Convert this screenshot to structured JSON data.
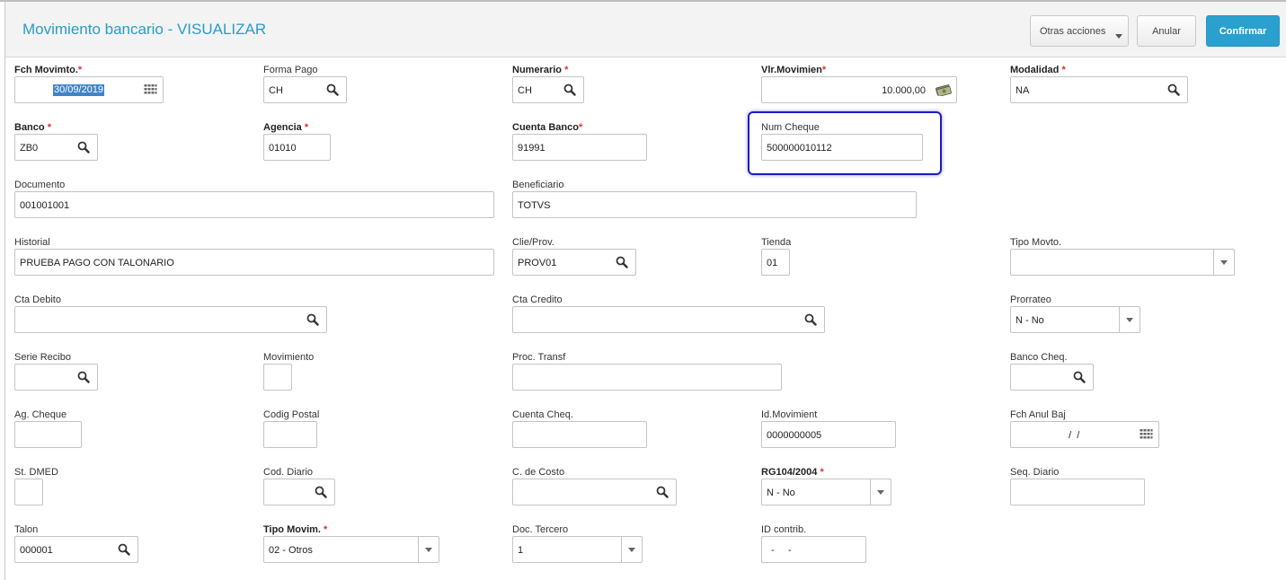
{
  "header": {
    "title": "Movimiento bancario - VISUALIZAR",
    "buttons": {
      "otras": "Otras acciones",
      "anular": "Anular",
      "confirmar": "Confirmar"
    }
  },
  "colors": {
    "accent": "#2aa0cf",
    "required": "#e03030",
    "highlight": "#1a1acc"
  },
  "fields": {
    "fch_movimto": {
      "label": "Fch Movimto.",
      "value": "30/09/2019"
    },
    "forma_pago": {
      "label": "Forma Pago",
      "value": "CH"
    },
    "numerario": {
      "label": "Numerario",
      "value": "CH"
    },
    "vlr_movimien": {
      "label": "Vlr.Movimien",
      "value": "10.000,00"
    },
    "modalidad": {
      "label": "Modalidad",
      "value": "NA"
    },
    "banco": {
      "label": "Banco",
      "value": "ZB0"
    },
    "agencia": {
      "label": "Agencia",
      "value": "01010"
    },
    "cuenta_banco": {
      "label": "Cuenta Banco",
      "value": "91991"
    },
    "num_cheque": {
      "label": "Num Cheque",
      "value": "500000010112"
    },
    "documento": {
      "label": "Documento",
      "value": "001001001"
    },
    "beneficiario": {
      "label": "Beneficiario",
      "value": "TOTVS"
    },
    "historial": {
      "label": "Historial",
      "value": "PRUEBA PAGO CON TALONARIO"
    },
    "clie_prov": {
      "label": "Clie/Prov.",
      "value": "PROV01"
    },
    "tienda": {
      "label": "Tienda",
      "value": "01"
    },
    "tipo_movto": {
      "label": "Tipo Movto.",
      "value": ""
    },
    "cta_debito": {
      "label": "Cta Debito",
      "value": ""
    },
    "cta_credito": {
      "label": "Cta Credito",
      "value": ""
    },
    "prorrateo": {
      "label": "Prorrateo",
      "value": "N - No"
    },
    "serie_recibo": {
      "label": "Serie Recibo",
      "value": ""
    },
    "movimiento": {
      "label": "Movimiento",
      "value": ""
    },
    "proc_transf": {
      "label": "Proc. Transf",
      "value": ""
    },
    "banco_cheq": {
      "label": "Banco Cheq.",
      "value": ""
    },
    "ag_cheque": {
      "label": "Ag. Cheque",
      "value": ""
    },
    "codig_postal": {
      "label": "Codig Postal",
      "value": ""
    },
    "cuenta_cheq": {
      "label": "Cuenta Cheq.",
      "value": ""
    },
    "id_movimient": {
      "label": "Id.Movimient",
      "value": "0000000005"
    },
    "fch_anul_baj": {
      "label": "Fch Anul Baj",
      "value": "  /  /"
    },
    "st_dmed": {
      "label": "St. DMED",
      "value": ""
    },
    "cod_diario": {
      "label": "Cod. Diario",
      "value": ""
    },
    "c_de_costo": {
      "label": "C. de Costo",
      "value": ""
    },
    "rg104": {
      "label": "RG104/2004",
      "value": "N - No"
    },
    "seq_diario": {
      "label": "Seq. Diario",
      "value": ""
    },
    "talon": {
      "label": "Talon",
      "value": "000001"
    },
    "tipo_movim": {
      "label": "Tipo Movim.",
      "value": "02 - Otros"
    },
    "doc_tercero": {
      "label": "Doc. Tercero",
      "value": "1"
    },
    "id_contrib": {
      "label": "ID contrib.",
      "value": "-     -"
    }
  },
  "required_mark": "*"
}
